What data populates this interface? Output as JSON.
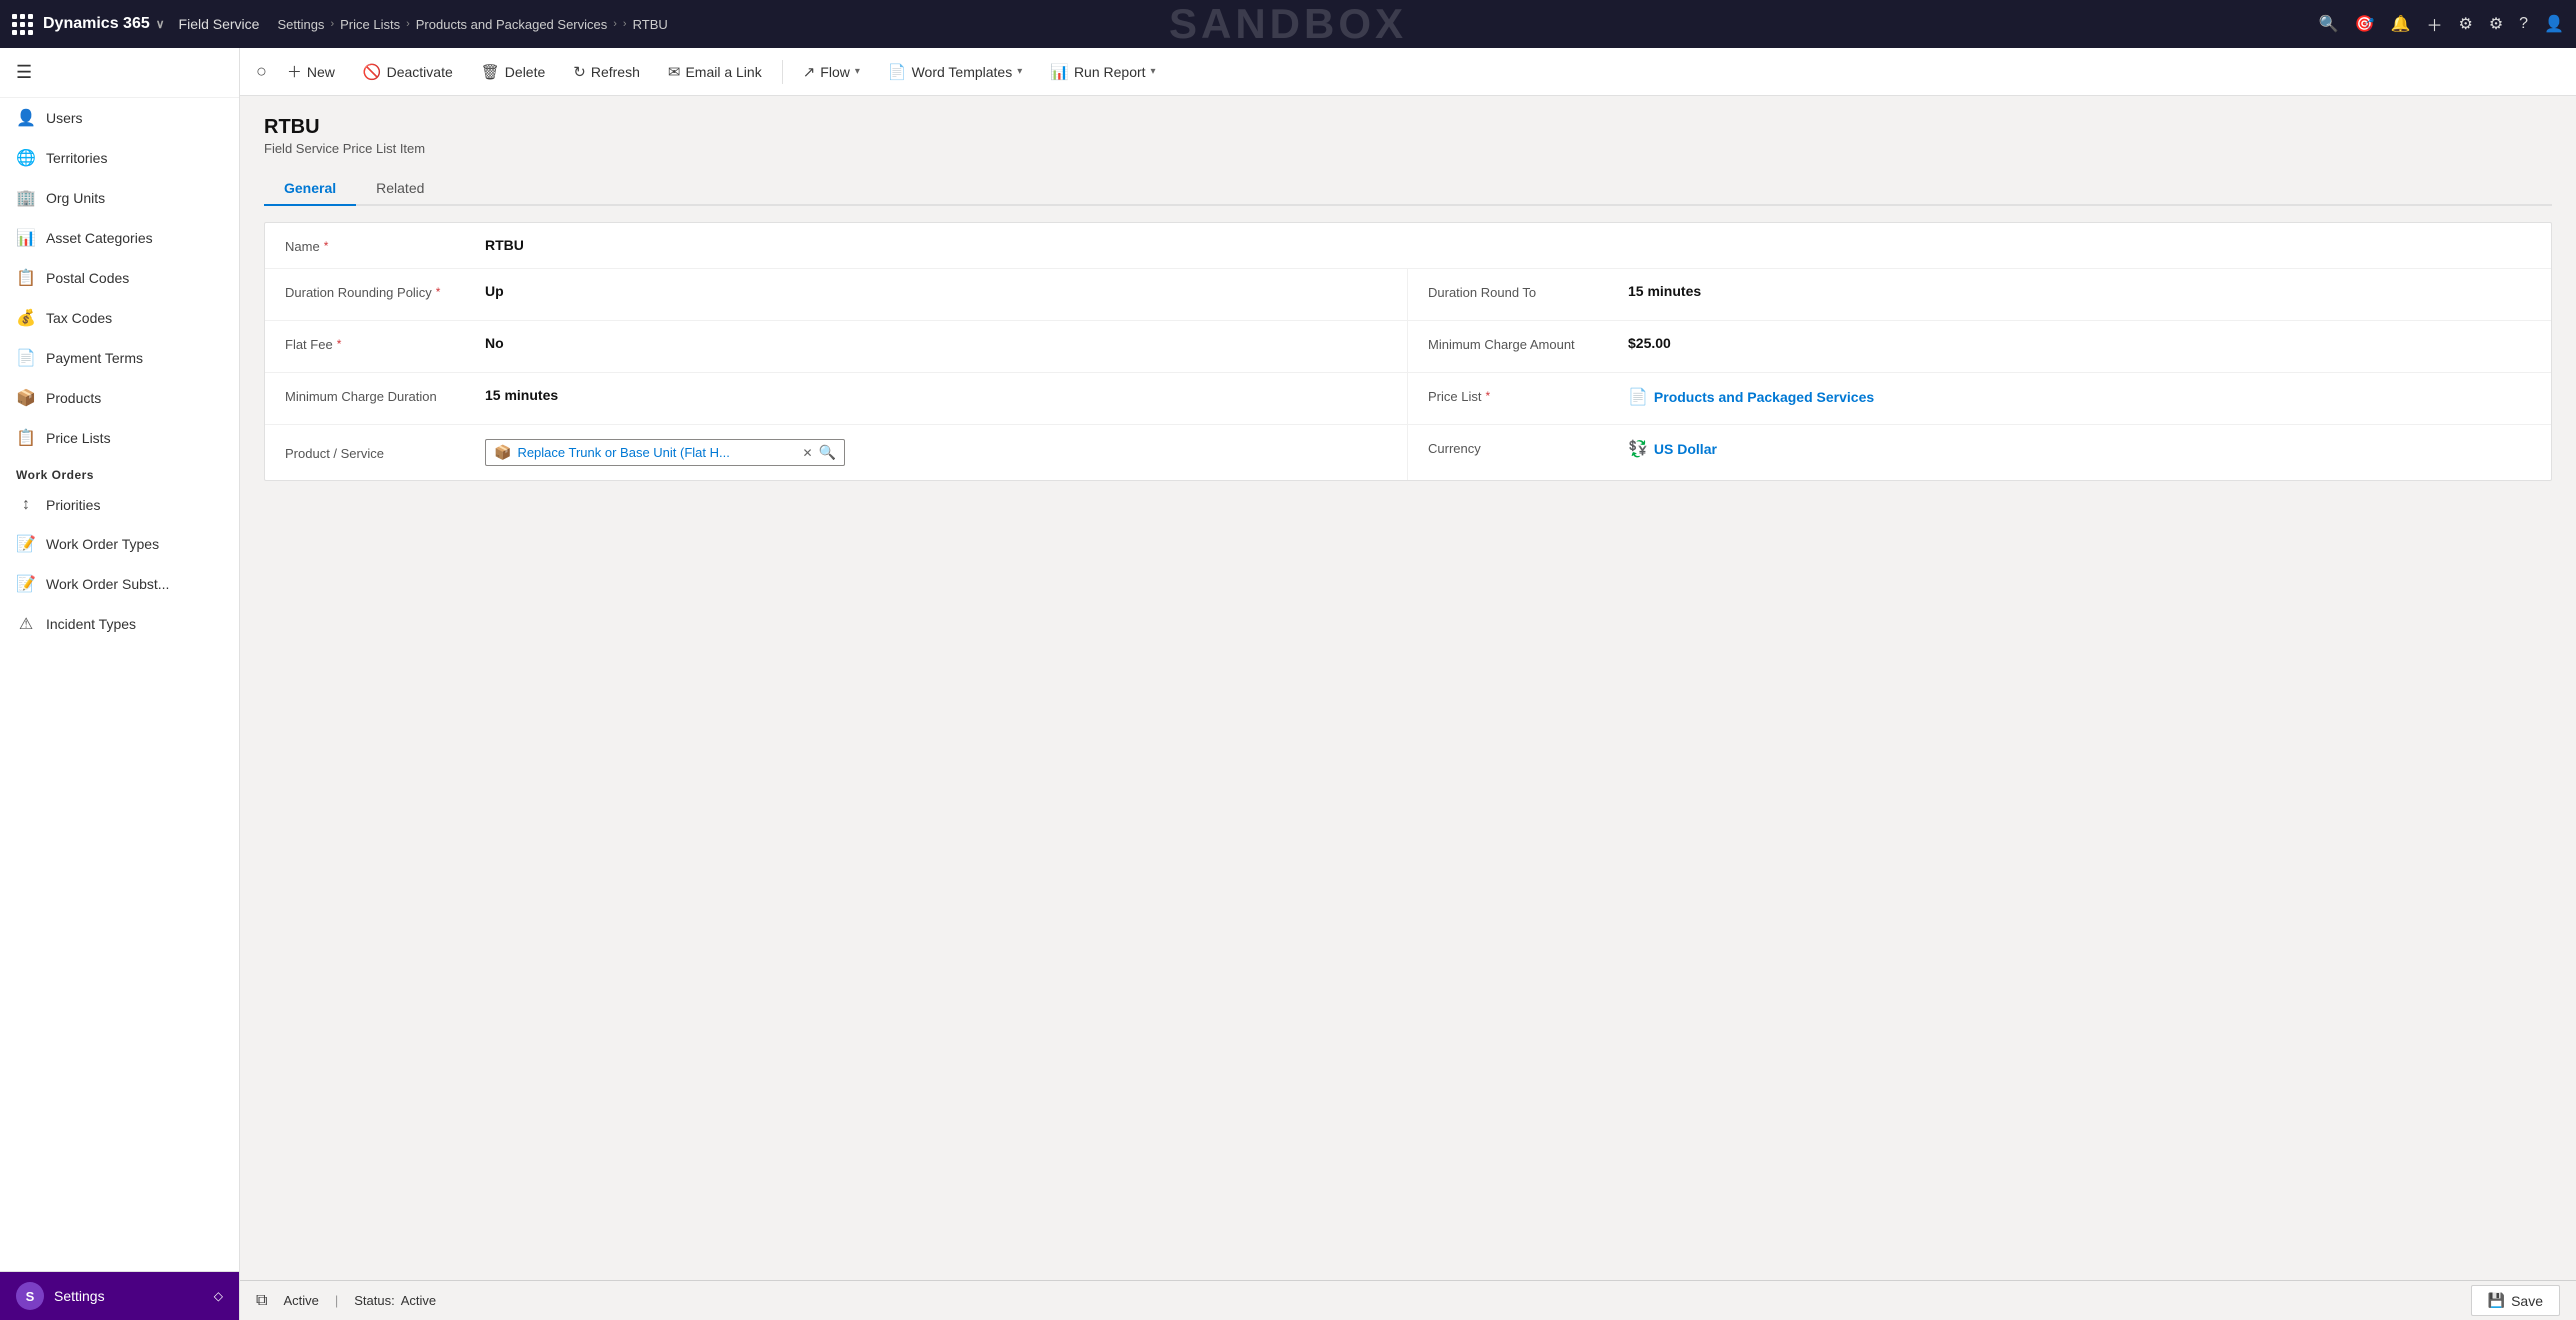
{
  "topnav": {
    "brand": "Dynamics 365",
    "brand_chevron": "∨",
    "app_name": "Field Service",
    "breadcrumbs": [
      "Settings",
      "Price Lists",
      "Products and Packaged Services",
      "RTBU"
    ],
    "sandbox_label": "SANDBOX"
  },
  "toolbar": {
    "new_label": "New",
    "deactivate_label": "Deactivate",
    "delete_label": "Delete",
    "refresh_label": "Refresh",
    "email_label": "Email a Link",
    "flow_label": "Flow",
    "word_templates_label": "Word Templates",
    "run_report_label": "Run Report"
  },
  "sidebar": {
    "hamburger": "☰",
    "items": [
      {
        "id": "users",
        "label": "Users",
        "icon": "👤"
      },
      {
        "id": "territories",
        "label": "Territories",
        "icon": "🌐"
      },
      {
        "id": "org-units",
        "label": "Org Units",
        "icon": "🏢"
      },
      {
        "id": "asset-categories",
        "label": "Asset Categories",
        "icon": "📊"
      },
      {
        "id": "postal-codes",
        "label": "Postal Codes",
        "icon": "📋"
      },
      {
        "id": "tax-codes",
        "label": "Tax Codes",
        "icon": "💰"
      },
      {
        "id": "payment-terms",
        "label": "Payment Terms",
        "icon": "📄"
      },
      {
        "id": "products",
        "label": "Products",
        "icon": "📦"
      },
      {
        "id": "price-lists",
        "label": "Price Lists",
        "icon": "📋"
      }
    ],
    "work_orders_section": "Work Orders",
    "work_order_items": [
      {
        "id": "priorities",
        "label": "Priorities",
        "icon": "↕"
      },
      {
        "id": "work-order-types",
        "label": "Work Order Types",
        "icon": "📝"
      },
      {
        "id": "work-order-subst",
        "label": "Work Order Subst...",
        "icon": "📝"
      },
      {
        "id": "incident-types",
        "label": "Incident Types",
        "icon": "⚠"
      }
    ],
    "bottom_label": "Settings",
    "bottom_avatar": "S"
  },
  "page": {
    "title": "RTBU",
    "subtitle": "Field Service Price List Item",
    "tabs": [
      {
        "id": "general",
        "label": "General",
        "active": true
      },
      {
        "id": "related",
        "label": "Related",
        "active": false
      }
    ],
    "form": {
      "name_label": "Name",
      "name_required": true,
      "name_value": "RTBU",
      "duration_rounding_label": "Duration Rounding Policy",
      "duration_rounding_required": true,
      "duration_rounding_value": "Up",
      "duration_round_to_label": "Duration Round To",
      "duration_round_to_value": "15 minutes",
      "flat_fee_label": "Flat Fee",
      "flat_fee_required": true,
      "flat_fee_value": "No",
      "min_charge_amount_label": "Minimum Charge Amount",
      "min_charge_amount_value": "$25.00",
      "min_charge_duration_label": "Minimum Charge Duration",
      "min_charge_duration_value": "15 minutes",
      "price_list_label": "Price List",
      "price_list_required": true,
      "price_list_value": "Products and Packaged Services",
      "product_service_label": "Product / Service",
      "product_service_value": "Replace Trunk or Base Unit (Flat H...",
      "currency_label": "Currency",
      "currency_value": "US Dollar"
    },
    "status_bar": {
      "active_label": "Active",
      "status_label": "Status:",
      "status_value": "Active",
      "save_label": "Save",
      "save_icon": "💾"
    }
  }
}
